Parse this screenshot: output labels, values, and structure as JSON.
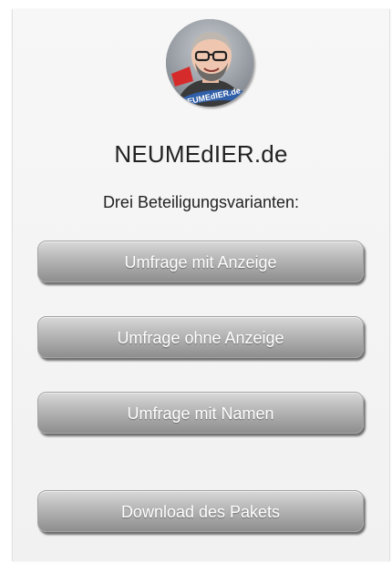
{
  "header": {
    "site_title": "NEUMEdIER.de",
    "subtitle": "Drei Beteiligungsvarianten:",
    "avatar_badge_text": "NEUMEdIER.de"
  },
  "buttons": {
    "survey_with_ad": "Umfrage mit Anzeige",
    "survey_without_ad": "Umfrage ohne Anzeige",
    "survey_with_names": "Umfrage mit Namen",
    "download_package": "Download des Pakets"
  },
  "colors": {
    "panel_background": "#f4f4f4",
    "button_gradient_top": "#d9d9d9",
    "button_gradient_bottom": "#8e8e8e",
    "button_text": "#ffffff",
    "title_text": "#222222"
  }
}
